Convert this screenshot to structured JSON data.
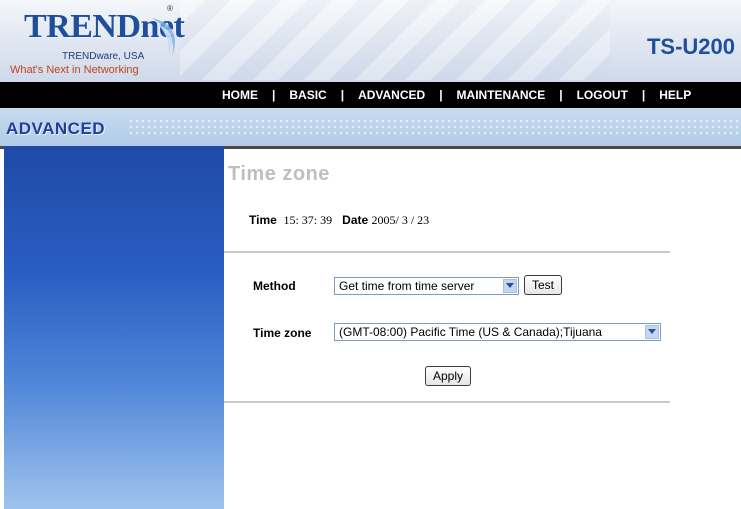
{
  "header": {
    "logo_main": "TRENDnet",
    "logo_reg": "®",
    "logo_sub1": "TRENDware, USA",
    "logo_sub2": "What's Next in Networking",
    "model": "TS-U200"
  },
  "nav": {
    "items": [
      "HOME",
      "BASIC",
      "ADVANCED",
      "MAINTENANCE",
      "LOGOUT",
      "HELP"
    ],
    "separator": "|"
  },
  "section": {
    "title": "ADVANCED"
  },
  "page": {
    "title": "Time zone",
    "time_label": "Time",
    "time_value": "15: 37: 39",
    "date_label": "Date",
    "date_value": "2005/ 3  / 23"
  },
  "form": {
    "method_label": "Method",
    "method_value": "Get time from time server",
    "test_label": "Test",
    "timezone_label": "Time zone",
    "timezone_value": "(GMT-08:00) Pacific Time (US & Canada);Tijuana",
    "apply_label": "Apply"
  },
  "colors": {
    "brand": "#1f4f9a",
    "nav_bg": "#000000",
    "band_bg": "#b2cbe8",
    "sidebar_top": "#1f4aa8",
    "sidebar_bottom": "#9fc3ee",
    "title_gray": "#bfbfbf"
  },
  "icons": {
    "dropdown": "chevron-down-icon"
  }
}
